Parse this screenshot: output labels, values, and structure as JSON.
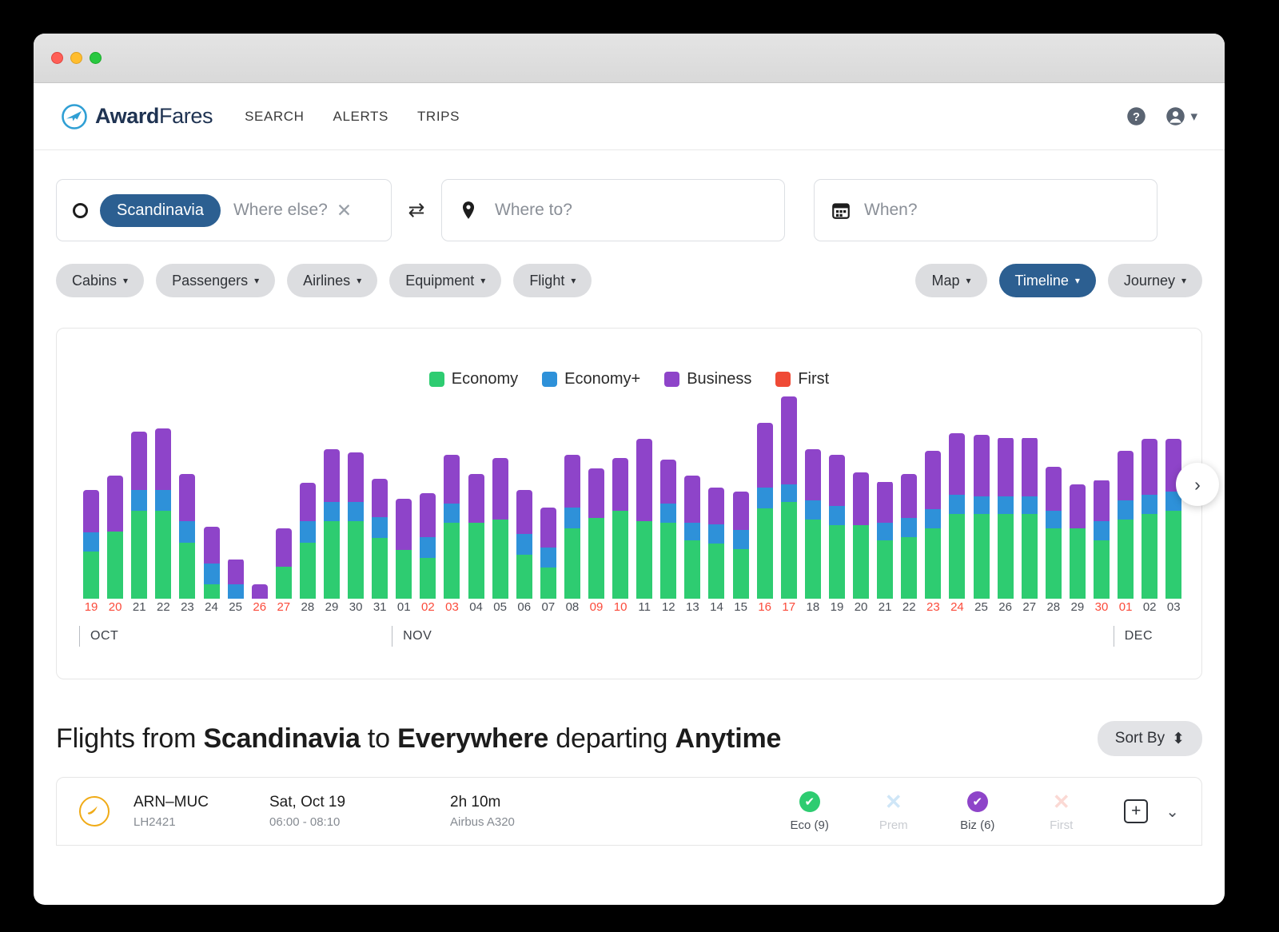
{
  "window": {
    "traffic_lights": [
      "close",
      "minimize",
      "maximize"
    ]
  },
  "nav": {
    "brand_bold": "Award",
    "brand_light": "Fares",
    "links": [
      "SEARCH",
      "ALERTS",
      "TRIPS"
    ],
    "help_icon": "help-circle-icon",
    "account_icon": "account-circle-icon",
    "account_caret": "▾"
  },
  "search": {
    "origin": {
      "chip": "Scandinavia",
      "placeholder": "Where else?",
      "clear": "✕",
      "radio_icon": "circle-icon"
    },
    "swap_icon": "⇄",
    "destination": {
      "placeholder": "Where to?",
      "icon": "map-pin-icon"
    },
    "when": {
      "placeholder": "When?",
      "icon": "calendar-icon"
    }
  },
  "filters": {
    "left": [
      {
        "label": "Cabins",
        "active": false
      },
      {
        "label": "Passengers",
        "active": false
      },
      {
        "label": "Airlines",
        "active": false
      },
      {
        "label": "Equipment",
        "active": false
      },
      {
        "label": "Flight",
        "active": false
      }
    ],
    "right": [
      {
        "label": "Map",
        "active": false
      },
      {
        "label": "Timeline",
        "active": true
      },
      {
        "label": "Journey",
        "active": false
      }
    ],
    "caret": "▾"
  },
  "chart_card": {
    "next_icon": "chevron-right-icon"
  },
  "chart_data": {
    "type": "bar",
    "title": "",
    "stacked": true,
    "xlabel": "",
    "ylabel": "",
    "grid": false,
    "legend_position": "top-center",
    "legend": [
      {
        "name": "Economy",
        "color": "#2ecc71"
      },
      {
        "name": "Economy+",
        "color": "#2e91d9"
      },
      {
        "name": "Business",
        "color": "#8e44c9"
      },
      {
        "name": "First",
        "color": "#ef4a36"
      }
    ],
    "series": [
      {
        "name": "Economy",
        "color": "#2ecc71",
        "values": [
          32,
          46,
          60,
          60,
          38,
          10,
          0,
          0,
          22,
          38,
          53,
          53,
          42,
          33,
          28,
          52,
          52,
          54,
          30,
          21,
          48,
          55,
          60,
          53,
          52,
          40,
          38,
          34,
          62,
          66,
          54,
          50,
          50,
          40,
          42,
          48,
          58,
          58,
          58,
          58,
          48,
          48,
          40,
          54,
          58,
          60
        ]
      },
      {
        "name": "Economy+",
        "color": "#2e91d9",
        "values": [
          13,
          0,
          14,
          14,
          15,
          14,
          10,
          0,
          0,
          15,
          13,
          13,
          14,
          0,
          14,
          13,
          0,
          0,
          14,
          14,
          14,
          0,
          0,
          0,
          13,
          12,
          13,
          13,
          14,
          12,
          13,
          13,
          0,
          12,
          13,
          13,
          13,
          12,
          12,
          12,
          12,
          0,
          13,
          13,
          13,
          13
        ]
      },
      {
        "name": "Business",
        "color": "#8e44c9",
        "values": [
          29,
          38,
          40,
          42,
          32,
          25,
          17,
          10,
          26,
          26,
          36,
          34,
          26,
          35,
          30,
          33,
          33,
          42,
          30,
          27,
          36,
          34,
          36,
          56,
          30,
          32,
          25,
          26,
          44,
          60,
          35,
          35,
          36,
          28,
          30,
          40,
          42,
          42,
          40,
          40,
          30,
          30,
          28,
          34,
          38,
          36
        ]
      },
      {
        "name": "First",
        "color": "#ef4a36",
        "values": [
          0,
          0,
          0,
          0,
          0,
          0,
          0,
          0,
          0,
          0,
          0,
          0,
          0,
          0,
          0,
          0,
          0,
          0,
          0,
          0,
          0,
          0,
          0,
          0,
          0,
          0,
          0,
          0,
          0,
          0,
          0,
          0,
          0,
          0,
          0,
          0,
          0,
          0,
          0,
          0,
          0,
          0,
          0,
          0,
          0,
          0
        ]
      }
    ],
    "categories": [
      {
        "label": "19",
        "weekend": true
      },
      {
        "label": "20",
        "weekend": true
      },
      {
        "label": "21",
        "weekend": false
      },
      {
        "label": "22",
        "weekend": false
      },
      {
        "label": "23",
        "weekend": false
      },
      {
        "label": "24",
        "weekend": false
      },
      {
        "label": "25",
        "weekend": false
      },
      {
        "label": "26",
        "weekend": true
      },
      {
        "label": "27",
        "weekend": true
      },
      {
        "label": "28",
        "weekend": false
      },
      {
        "label": "29",
        "weekend": false
      },
      {
        "label": "30",
        "weekend": false
      },
      {
        "label": "31",
        "weekend": false
      },
      {
        "label": "01",
        "weekend": false
      },
      {
        "label": "02",
        "weekend": true
      },
      {
        "label": "03",
        "weekend": true
      },
      {
        "label": "04",
        "weekend": false
      },
      {
        "label": "05",
        "weekend": false
      },
      {
        "label": "06",
        "weekend": false
      },
      {
        "label": "07",
        "weekend": false
      },
      {
        "label": "08",
        "weekend": false
      },
      {
        "label": "09",
        "weekend": true
      },
      {
        "label": "10",
        "weekend": true
      },
      {
        "label": "11",
        "weekend": false
      },
      {
        "label": "12",
        "weekend": false
      },
      {
        "label": "13",
        "weekend": false
      },
      {
        "label": "14",
        "weekend": false
      },
      {
        "label": "15",
        "weekend": false
      },
      {
        "label": "16",
        "weekend": true
      },
      {
        "label": "17",
        "weekend": true
      },
      {
        "label": "18",
        "weekend": false
      },
      {
        "label": "19",
        "weekend": false
      },
      {
        "label": "20",
        "weekend": false
      },
      {
        "label": "21",
        "weekend": false
      },
      {
        "label": "22",
        "weekend": false
      },
      {
        "label": "23",
        "weekend": true
      },
      {
        "label": "24",
        "weekend": true
      },
      {
        "label": "25",
        "weekend": false
      },
      {
        "label": "26",
        "weekend": false
      },
      {
        "label": "27",
        "weekend": false
      },
      {
        "label": "28",
        "weekend": false
      },
      {
        "label": "29",
        "weekend": false
      },
      {
        "label": "30",
        "weekend": true
      },
      {
        "label": "01",
        "weekend": true
      },
      {
        "label": "02",
        "weekend": false
      },
      {
        "label": "03",
        "weekend": false
      }
    ],
    "months": [
      {
        "label": "OCT",
        "start_index": 0
      },
      {
        "label": "NOV",
        "start_index": 13
      },
      {
        "label": "DEC",
        "start_index": 43
      }
    ],
    "ylim": [
      0,
      120
    ]
  },
  "results": {
    "title_prefix": "Flights from ",
    "origin": "Scandinavia",
    "title_mid": " to ",
    "destination": "Everywhere",
    "title_mid2": " departing ",
    "when": "Anytime",
    "sort_by": "Sort By",
    "sort_icon": "⬍",
    "rows": [
      {
        "airline_icon": "lufthansa-logo-icon",
        "route": "ARN–MUC",
        "flight_no": "LH2421",
        "date": "Sat, Oct 19",
        "times": "06:00 - 08:10",
        "duration": "2h 10m",
        "aircraft": "Airbus A320",
        "cabins": [
          {
            "label": "Eco (9)",
            "state": "available",
            "color": "#2ecc71",
            "glyph": "✔"
          },
          {
            "label": "Prem",
            "state": "unavailable",
            "color": "#cfe6f7",
            "glyph": "✕"
          },
          {
            "label": "Biz (6)",
            "state": "available",
            "color": "#8e44c9",
            "glyph": "✔"
          },
          {
            "label": "First",
            "state": "unavailable",
            "color": "#fbd9d4",
            "glyph": "✕"
          }
        ],
        "add_icon": "plus-box-icon",
        "expand_icon": "chevron-down-icon"
      }
    ]
  }
}
